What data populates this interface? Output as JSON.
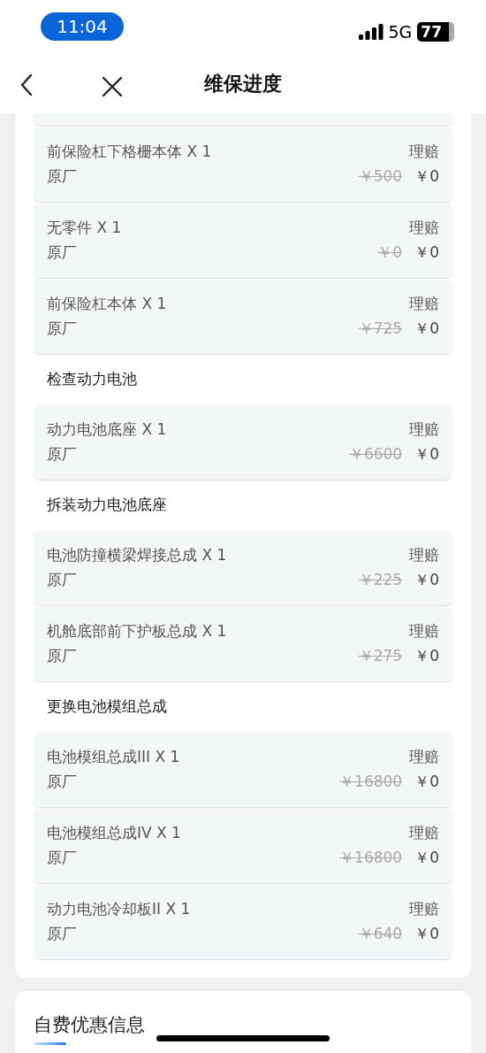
{
  "status_bar": {
    "time": "11:04",
    "network": "5G",
    "battery": "77"
  },
  "nav": {
    "title": "维保进度"
  },
  "sections": [
    {
      "items": [
        {
          "name": "前保险杠下格栅本体 X 1",
          "source": "原厂",
          "type": "理赔",
          "original_price": "￥500",
          "price": "￥0"
        },
        {
          "name": "无零件 X 1",
          "source": "原厂",
          "type": "理赔",
          "original_price": "￥0",
          "price": "￥0"
        },
        {
          "name": "前保险杠本体 X 1",
          "source": "原厂",
          "type": "理赔",
          "original_price": "￥725",
          "price": "￥0"
        }
      ]
    },
    {
      "heading": "检查动力电池",
      "items": [
        {
          "name": "动力电池底座 X 1",
          "source": "原厂",
          "type": "理赔",
          "original_price": "￥6600",
          "price": "￥0"
        }
      ]
    },
    {
      "heading": "拆装动力电池底座",
      "items": [
        {
          "name": "电池防撞横梁焊接总成 X 1",
          "source": "原厂",
          "type": "理赔",
          "original_price": "￥225",
          "price": "￥0"
        },
        {
          "name": "机舱底部前下护板总成 X 1",
          "source": "原厂",
          "type": "理赔",
          "original_price": "￥275",
          "price": "￥0"
        }
      ]
    },
    {
      "heading": "更换电池模组总成",
      "items": [
        {
          "name": "电池模组总成III X 1",
          "source": "原厂",
          "type": "理赔",
          "original_price": "￥16800",
          "price": "￥0"
        },
        {
          "name": "电池模组总成IV X 1",
          "source": "原厂",
          "type": "理赔",
          "original_price": "￥16800",
          "price": "￥0"
        },
        {
          "name": "动力电池冷却板II X 1",
          "source": "原厂",
          "type": "理赔",
          "original_price": "￥640",
          "price": "￥0"
        }
      ]
    }
  ],
  "discount_card": {
    "title": "自费优惠信息"
  }
}
